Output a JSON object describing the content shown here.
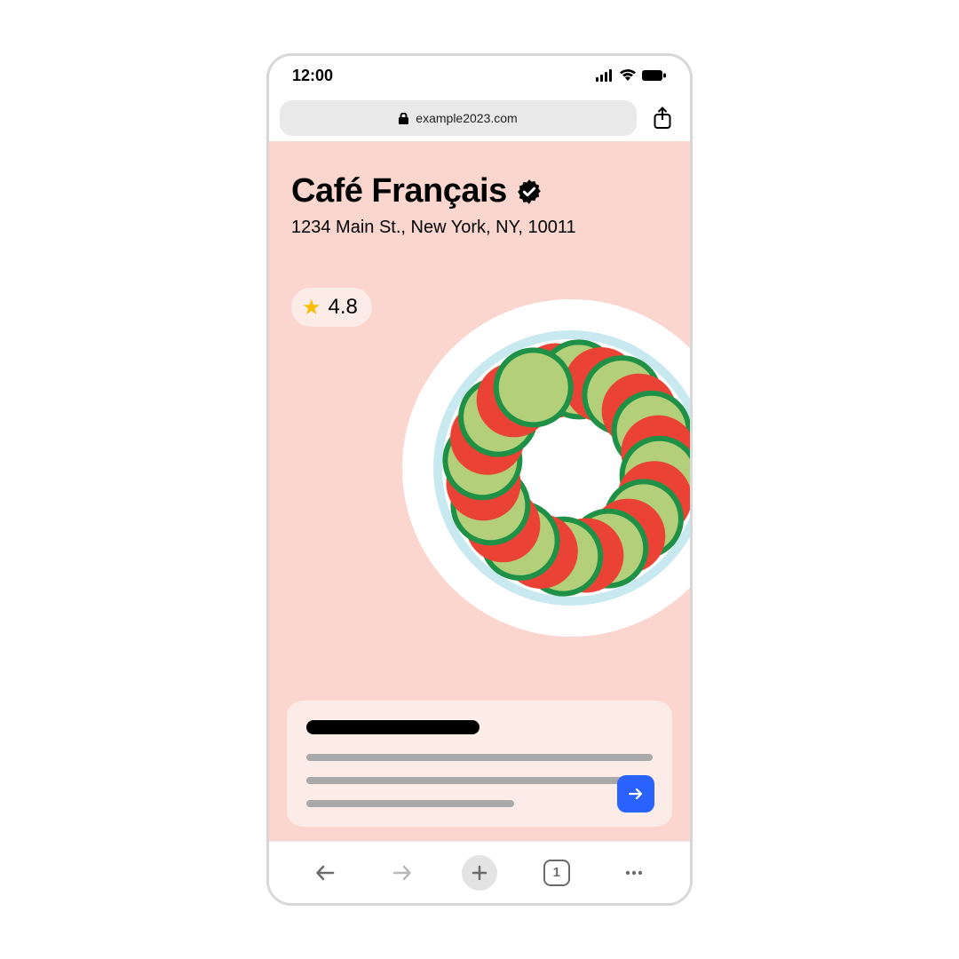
{
  "status": {
    "time": "12:00"
  },
  "browser": {
    "url": "example2023.com",
    "tab_count": "1"
  },
  "page": {
    "title": "Café Français",
    "address": "1234 Main St., New York, NY, 10011",
    "rating": "4.8"
  }
}
